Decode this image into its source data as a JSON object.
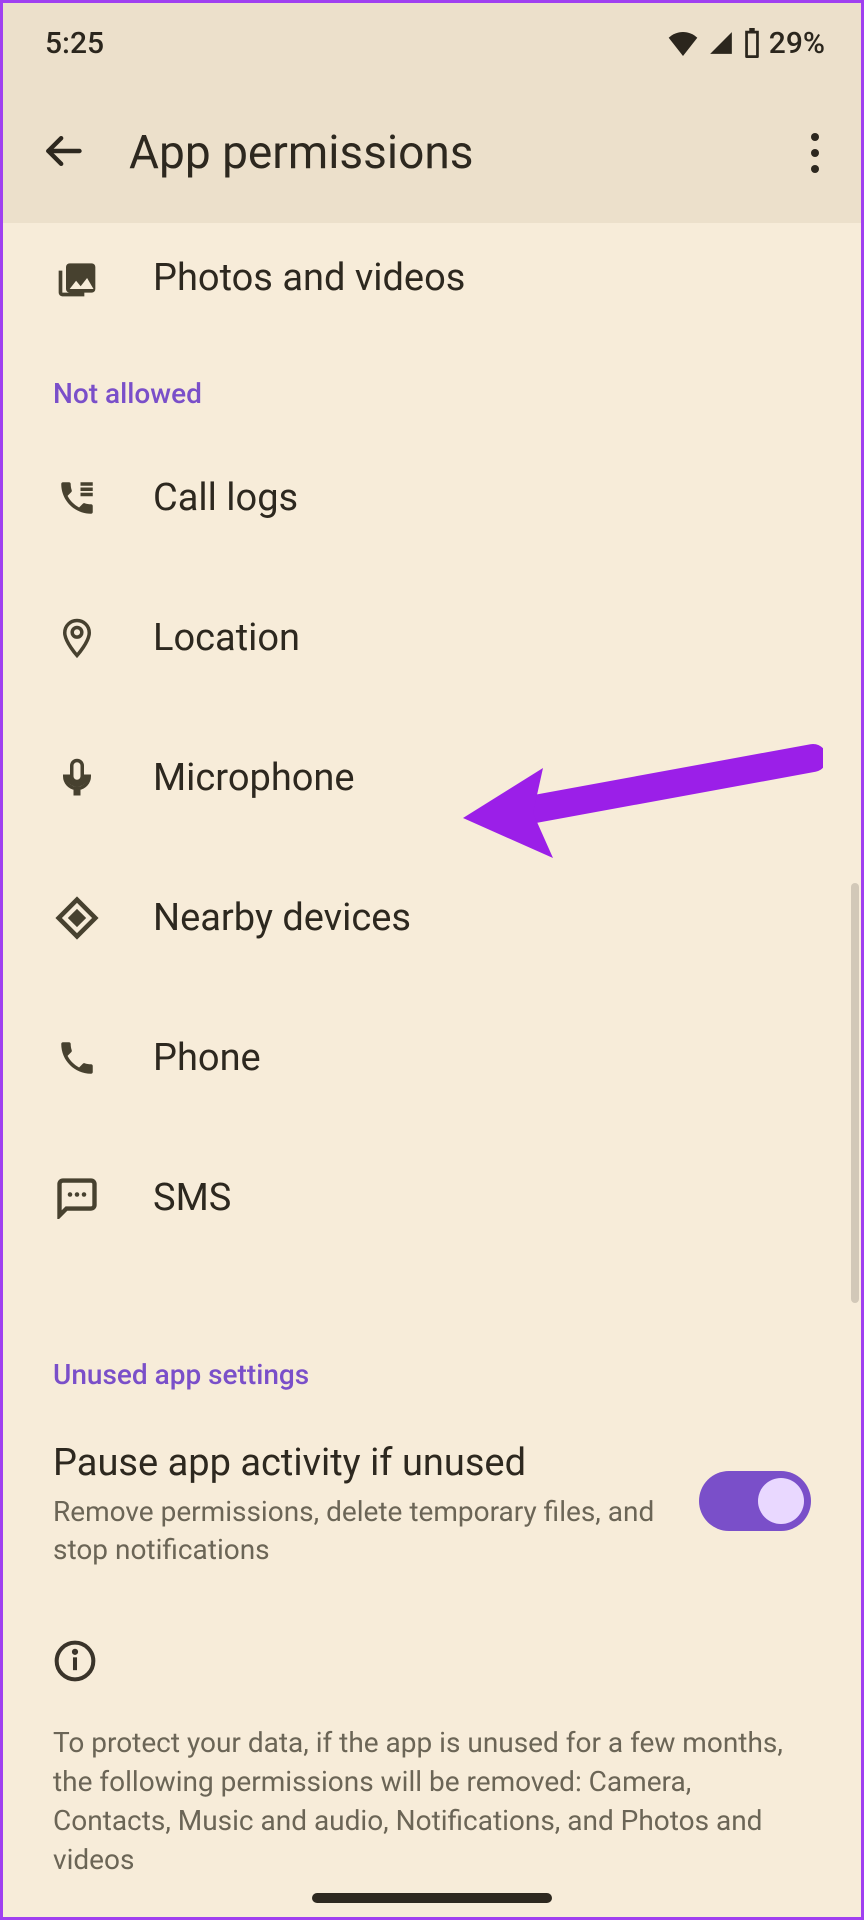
{
  "status": {
    "time": "5:25",
    "battery_text": "29%"
  },
  "header": {
    "title": "App permissions"
  },
  "permissions_visible_top": {
    "label": "Photos and videos"
  },
  "section_not_allowed": "Not allowed",
  "not_allowed_items": [
    {
      "id": "call-logs",
      "label": "Call logs"
    },
    {
      "id": "location",
      "label": "Location"
    },
    {
      "id": "microphone",
      "label": "Microphone"
    },
    {
      "id": "nearby",
      "label": "Nearby devices"
    },
    {
      "id": "phone",
      "label": "Phone"
    },
    {
      "id": "sms",
      "label": "SMS"
    }
  ],
  "section_unused": "Unused app settings",
  "pause_setting": {
    "title": "Pause app activity if unused",
    "subtitle": "Remove permissions, delete temporary files, and stop notifications",
    "enabled": true
  },
  "info_text": "To protect your data, if the app is unused for a few months, the following permissions will be removed: Camera, Contacts, Music and audio, Notifications, and Photos and videos"
}
